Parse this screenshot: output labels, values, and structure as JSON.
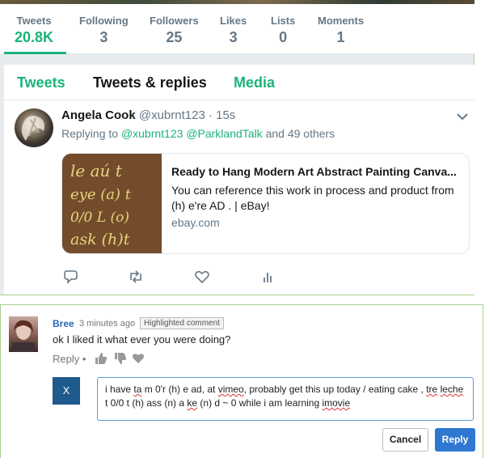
{
  "stats": [
    {
      "label": "Tweets",
      "value": "20.8K"
    },
    {
      "label": "Following",
      "value": "3"
    },
    {
      "label": "Followers",
      "value": "25"
    },
    {
      "label": "Likes",
      "value": "3"
    },
    {
      "label": "Lists",
      "value": "0"
    },
    {
      "label": "Moments",
      "value": "1"
    }
  ],
  "tabs": [
    "Tweets",
    "Tweets & replies",
    "Media"
  ],
  "tweet": {
    "name": "Angela Cook",
    "handle": "@xubrnt123 · 15s",
    "replying_prefix": "Replying to ",
    "reply_user1": "@xubrnt123",
    "reply_user2": "@ParklandTalk",
    "reply_suffix": " and 49 others",
    "card": {
      "title": "Ready to Hang Modern Art Abstract Painting Canva...",
      "description": "You can reference this work in process and product from (h) e're AD . | eBay!",
      "domain": "ebay.com",
      "image_lines": [
        "le aú t",
        "eye (a) t",
        "0/0 L (o)",
        "ask (h)t"
      ]
    }
  },
  "comment": {
    "name": "Bree",
    "time": "3 minutes ago",
    "badge": "Highlighted comment",
    "text": "ok I liked it what ever you were doing?",
    "reply_label": "Reply •"
  },
  "reply_form": {
    "avatar_letter": "X",
    "parts": [
      {
        "t": "i have ",
        "s": false
      },
      {
        "t": "ta",
        "s": true
      },
      {
        "t": " m 0'r (h) e ad,  at ",
        "s": false
      },
      {
        "t": "vimeo",
        "s": true
      },
      {
        "t": ",  probably get this up today / eating cake , ",
        "s": false
      },
      {
        "t": "tre",
        "s": true
      },
      {
        "t": " ",
        "s": false
      },
      {
        "t": "leche",
        "s": true
      },
      {
        "t": " t 0/0 t (h) ass (n) a ",
        "s": false
      },
      {
        "t": "ke",
        "s": true
      },
      {
        "t": " (n) d ~ 0 while i am learning ",
        "s": false
      },
      {
        "t": "imovie",
        "s": true
      }
    ],
    "cancel_label": "Cancel",
    "reply_label": "Reply"
  },
  "colors": {
    "accent_green": "#1ab37a",
    "link_blue": "#2a66b6",
    "button_blue": "#2f78d1"
  }
}
